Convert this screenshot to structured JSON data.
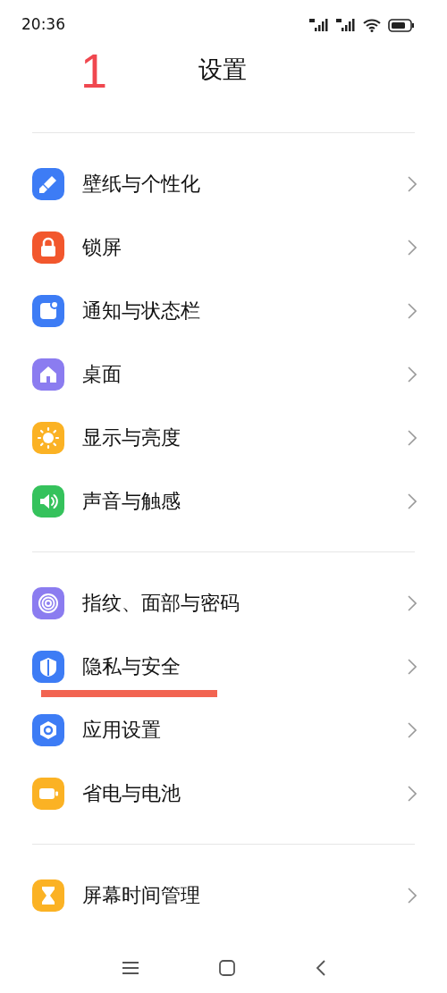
{
  "status_bar": {
    "time": "20:36"
  },
  "header": {
    "annotation": "1",
    "title": "设置"
  },
  "groups": [
    {
      "items": [
        {
          "label": "壁纸与个性化",
          "color": "#3d7cf5",
          "underlined": false
        },
        {
          "label": "锁屏",
          "color": "#f2572d",
          "underlined": false
        },
        {
          "label": "通知与状态栏",
          "color": "#3d7cf5",
          "underlined": false
        },
        {
          "label": "桌面",
          "color": "#8b7cf0",
          "underlined": false
        },
        {
          "label": "显示与亮度",
          "color": "#fbb224",
          "underlined": false
        },
        {
          "label": "声音与触感",
          "color": "#35c25c",
          "underlined": false
        }
      ]
    },
    {
      "items": [
        {
          "label": "指纹、面部与密码",
          "color": "#8b7cf0",
          "underlined": false
        },
        {
          "label": "隐私与安全",
          "color": "#3d7cf5",
          "underlined": true
        },
        {
          "label": "应用设置",
          "color": "#3d7cf5",
          "underlined": false
        },
        {
          "label": "省电与电池",
          "color": "#fbb224",
          "underlined": false
        }
      ]
    },
    {
      "items": [
        {
          "label": "屏幕时间管理",
          "color": "#fbb224",
          "underlined": false
        }
      ]
    }
  ]
}
